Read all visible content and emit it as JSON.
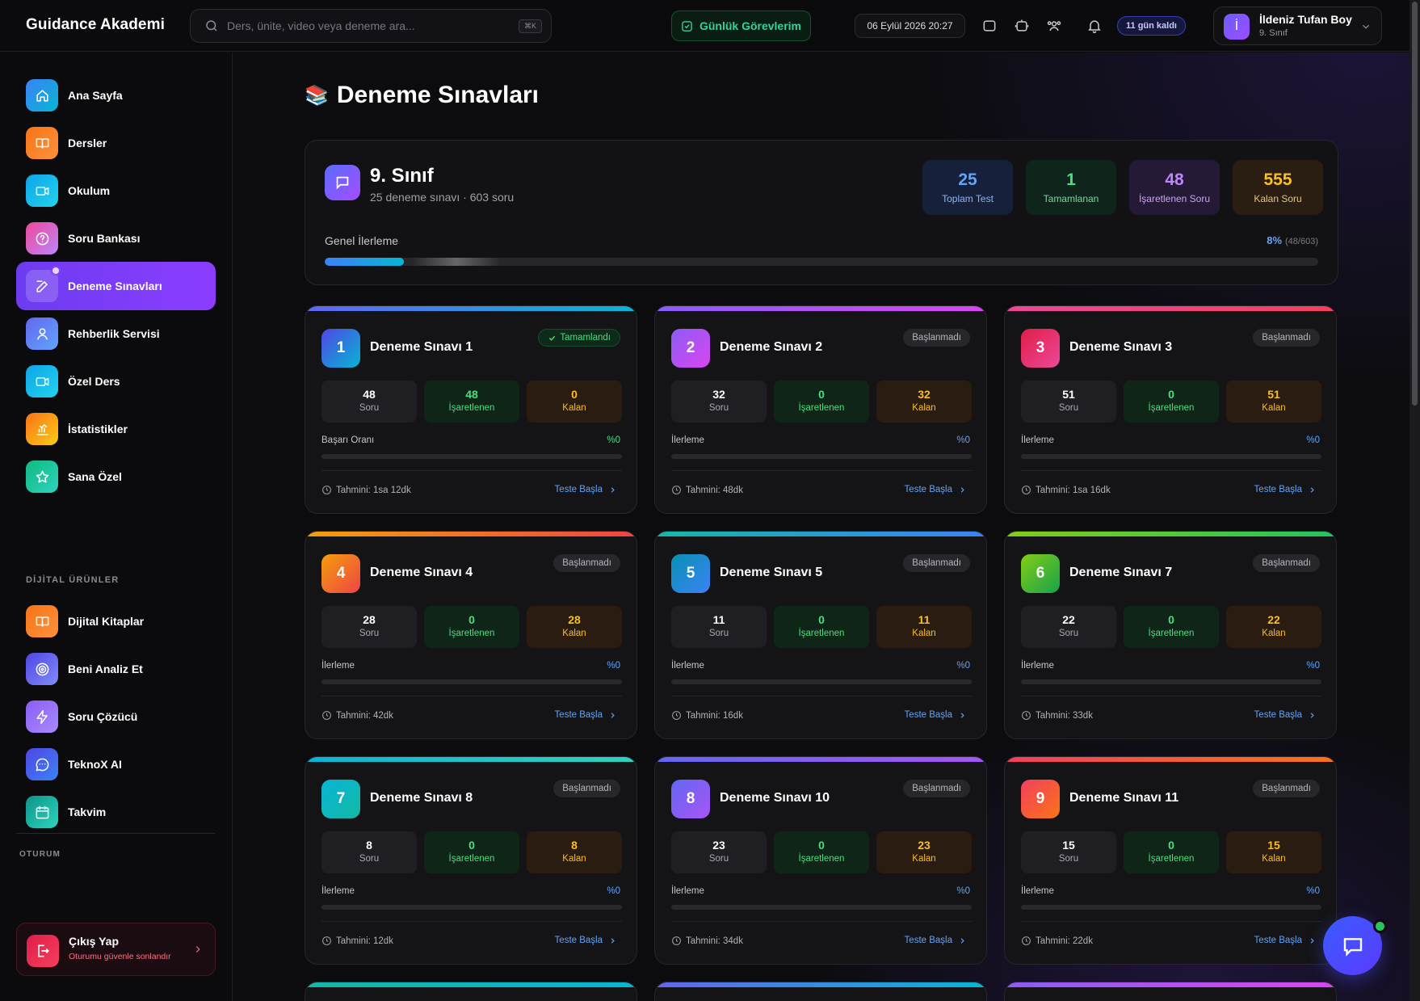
{
  "app": {
    "brand": "Guidance Akademi"
  },
  "topbar": {
    "search_placeholder": "Ders, ünite, video veya deneme ara...",
    "search_shortcut": "⌘K",
    "daily_tasks_label": "Günlük Görevlerim",
    "datetime": "06 Eylül 2026 20:27",
    "days_left": "11 gün kaldı",
    "user": {
      "initial": "İ",
      "name": "İldeniz Tufan Boy",
      "class": "9. Sınıf"
    }
  },
  "sidebar": {
    "items": [
      {
        "label": "Ana Sayfa",
        "icon": "home-icon"
      },
      {
        "label": "Dersler",
        "icon": "book-icon"
      },
      {
        "label": "Okulum",
        "icon": "video-icon"
      },
      {
        "label": "Soru Bankası",
        "icon": "question-icon"
      },
      {
        "label": "Deneme Sınavları",
        "icon": "edit-icon",
        "active": true
      },
      {
        "label": "Rehberlik Servisi",
        "icon": "user-icon"
      },
      {
        "label": "Özel Ders",
        "icon": "video-icon"
      },
      {
        "label": "İstatistikler",
        "icon": "chart-icon"
      },
      {
        "label": "Sana Özel",
        "icon": "star-icon"
      }
    ],
    "digital_heading": "DİJİTAL ÜRÜNLER",
    "digital_items": [
      {
        "label": "Dijital Kitaplar",
        "icon": "book-icon"
      },
      {
        "label": "Beni Analiz Et",
        "icon": "target-icon"
      },
      {
        "label": "Soru Çözücü",
        "icon": "bolt-icon"
      },
      {
        "label": "TeknoX AI",
        "icon": "ai-chat-icon"
      },
      {
        "label": "Takvim",
        "icon": "calendar-icon"
      }
    ],
    "session_heading": "OTURUM",
    "logout": {
      "title": "Çıkış Yap",
      "subtitle": "Oturumu güvenle sonlandır"
    }
  },
  "main": {
    "title": "Deneme Sınavları",
    "title_emoji": "📚",
    "summary": {
      "title": "9. Sınıf",
      "subtitle": "25 deneme sınavı · 603 soru",
      "stats": [
        {
          "value": "25",
          "label": "Toplam Test"
        },
        {
          "value": "1",
          "label": "Tamamlanan"
        },
        {
          "value": "48",
          "label": "İşaretlenen Soru"
        },
        {
          "value": "555",
          "label": "Kalan Soru"
        }
      ],
      "progress_label": "Genel İlerleme",
      "progress_pct": "8%",
      "progress_detail": "(48/603)",
      "progress_fraction": 0.08
    },
    "cards": [
      {
        "num": "1",
        "title": "Deneme Sınavı 1",
        "status": "Tamamlandı",
        "done": true,
        "soru": "48",
        "isaretlenen": "48",
        "kalan": "0",
        "progress_label": "Başarı Oranı",
        "pct": "%0",
        "estimate": "Tahmini: 1sa 12dk",
        "start": "Teste Başla"
      },
      {
        "num": "2",
        "title": "Deneme Sınavı 2",
        "status": "Başlanmadı",
        "done": false,
        "soru": "32",
        "isaretlenen": "0",
        "kalan": "32",
        "progress_label": "İlerleme",
        "pct": "%0",
        "estimate": "Tahmini: 48dk",
        "start": "Teste Başla"
      },
      {
        "num": "3",
        "title": "Deneme Sınavı 3",
        "status": "Başlanmadı",
        "done": false,
        "soru": "51",
        "isaretlenen": "0",
        "kalan": "51",
        "progress_label": "İlerleme",
        "pct": "%0",
        "estimate": "Tahmini: 1sa 16dk",
        "start": "Teste Başla"
      },
      {
        "num": "4",
        "title": "Deneme Sınavı 4",
        "status": "Başlanmadı",
        "done": false,
        "soru": "28",
        "isaretlenen": "0",
        "kalan": "28",
        "progress_label": "İlerleme",
        "pct": "%0",
        "estimate": "Tahmini: 42dk",
        "start": "Teste Başla"
      },
      {
        "num": "5",
        "title": "Deneme Sınavı 5",
        "status": "Başlanmadı",
        "done": false,
        "soru": "11",
        "isaretlenen": "0",
        "kalan": "11",
        "progress_label": "İlerleme",
        "pct": "%0",
        "estimate": "Tahmini: 16dk",
        "start": "Teste Başla"
      },
      {
        "num": "6",
        "title": "Deneme Sınavı 7",
        "status": "Başlanmadı",
        "done": false,
        "soru": "22",
        "isaretlenen": "0",
        "kalan": "22",
        "progress_label": "İlerleme",
        "pct": "%0",
        "estimate": "Tahmini: 33dk",
        "start": "Teste Başla"
      },
      {
        "num": "7",
        "title": "Deneme Sınavı 8",
        "status": "Başlanmadı",
        "done": false,
        "soru": "8",
        "isaretlenen": "0",
        "kalan": "8",
        "progress_label": "İlerleme",
        "pct": "%0",
        "estimate": "Tahmini: 12dk",
        "start": "Teste Başla"
      },
      {
        "num": "8",
        "title": "Deneme Sınavı 10",
        "status": "Başlanmadı",
        "done": false,
        "soru": "23",
        "isaretlenen": "0",
        "kalan": "23",
        "progress_label": "İlerleme",
        "pct": "%0",
        "estimate": "Tahmini: 34dk",
        "start": "Teste Başla"
      },
      {
        "num": "9",
        "title": "Deneme Sınavı 11",
        "status": "Başlanmadı",
        "done": false,
        "soru": "15",
        "isaretlenen": "0",
        "kalan": "15",
        "progress_label": "İlerleme",
        "pct": "%0",
        "estimate": "Tahmini: 22dk",
        "start": "Teste Başla"
      }
    ],
    "stat_labels": {
      "soru": "Soru",
      "isaretlenen": "İşaretlenen",
      "kalan": "Kalan"
    }
  },
  "colors": {
    "accent": "#8b3dff",
    "blue": "#60a5fa",
    "green": "#4ade80",
    "amber": "#fbbf24",
    "purple": "#c084fc"
  }
}
